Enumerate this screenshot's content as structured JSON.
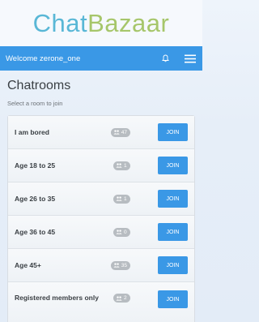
{
  "logo": {
    "part1": "Chat",
    "part2": "Bazaar"
  },
  "topbar": {
    "welcome": "Welcome zerone_one",
    "icons": [
      "bell-icon",
      "hamburger-menu-icon"
    ]
  },
  "page": {
    "title": "Chatrooms",
    "subtitle": "Select a room to join"
  },
  "rooms": [
    {
      "name": "I am bored",
      "count": "47",
      "join": "JOIN"
    },
    {
      "name": "Age 18 to 25",
      "count": "1",
      "join": "JOIN"
    },
    {
      "name": "Age 26 to 35",
      "count": "1",
      "join": "JOIN"
    },
    {
      "name": "Age 36 to 45",
      "count": "0",
      "join": "JOIN"
    },
    {
      "name": "Age 45+",
      "count": "35",
      "join": "JOIN"
    },
    {
      "name": "Registered members only",
      "count": "2",
      "join": "JOIN"
    }
  ],
  "colors": {
    "primary": "#3a98e6",
    "logo_blue": "#59b7d6",
    "logo_green": "#a6c66a",
    "badge": "#b7bcc1"
  }
}
